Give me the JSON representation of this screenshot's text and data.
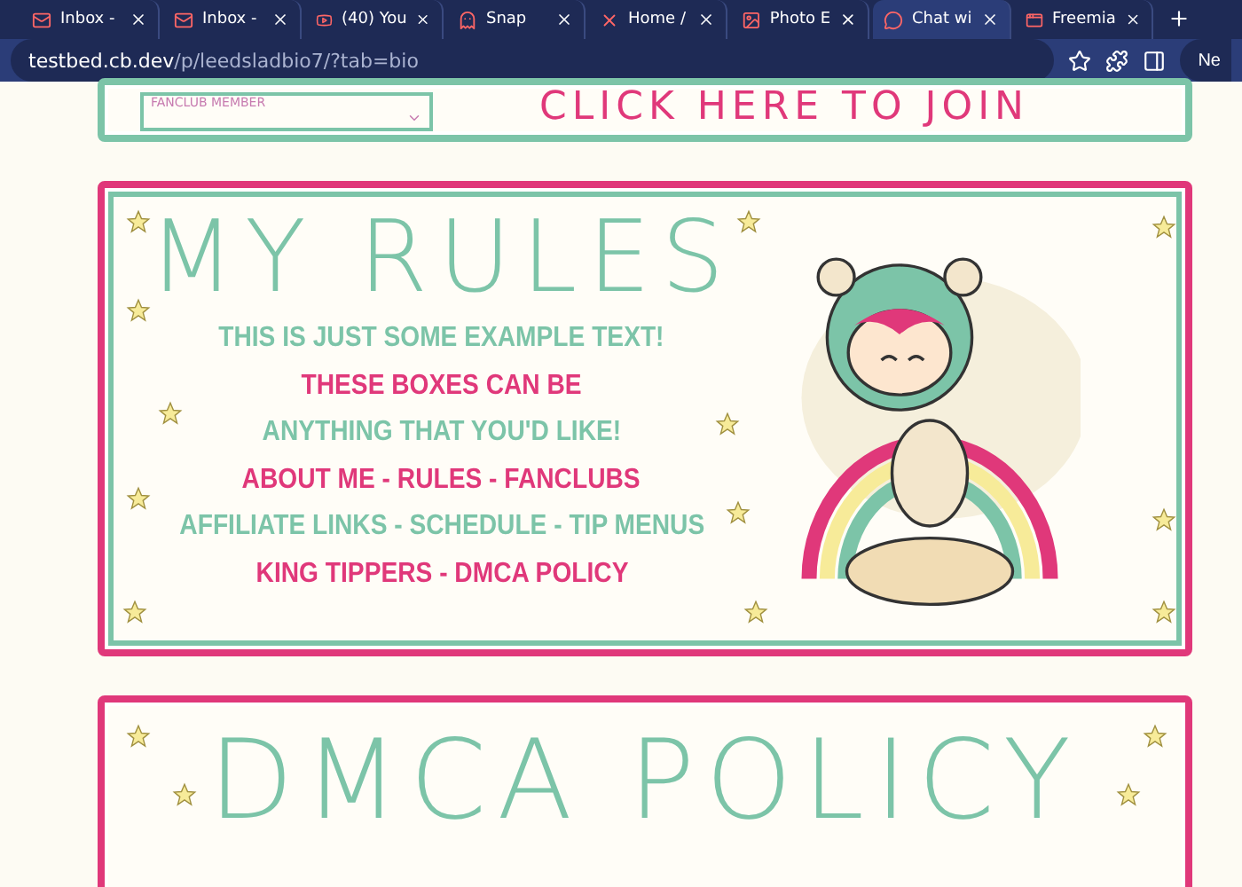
{
  "browser": {
    "tabs": [
      {
        "label": "Inbox -",
        "selected": false
      },
      {
        "label": "Inbox -",
        "selected": false
      },
      {
        "label": "(40) You",
        "selected": false
      },
      {
        "label": "Snap",
        "selected": false
      },
      {
        "label": "Home /",
        "selected": false
      },
      {
        "label": "Photo E",
        "selected": false
      },
      {
        "label": "Chat wi",
        "selected": true
      },
      {
        "label": "Freemia",
        "selected": false
      }
    ],
    "url_host": "testbed.cb.dev",
    "url_path": "/p/leedsladbio7/?tab=bio",
    "profile_button": "Ne"
  },
  "join_card": {
    "select_value": "FANCLUB MEMBER",
    "title": "CLICK HERE TO JOIN"
  },
  "rules_card": {
    "title": "MY RULES",
    "lines": [
      {
        "text": "THIS IS JUST SOME EXAMPLE TEXT!",
        "color": "#7cc4a8"
      },
      {
        "text": "THESE BOXES CAN BE",
        "color": "#e0387a"
      },
      {
        "text": "ANYTHING THAT YOU'D LIKE!",
        "color": "#7cc4a8"
      },
      {
        "text": "ABOUT ME - RULES - FANCLUBS",
        "color": "#e0387a"
      },
      {
        "text": "AFFILIATE LINKS - SCHEDULE - TIP MENUS",
        "color": "#7cc4a8"
      },
      {
        "text": "KING TIPPERS - DMCA POLICY",
        "color": "#e0387a"
      }
    ]
  },
  "dmca_card": {
    "title": "DMCA POLICY"
  }
}
